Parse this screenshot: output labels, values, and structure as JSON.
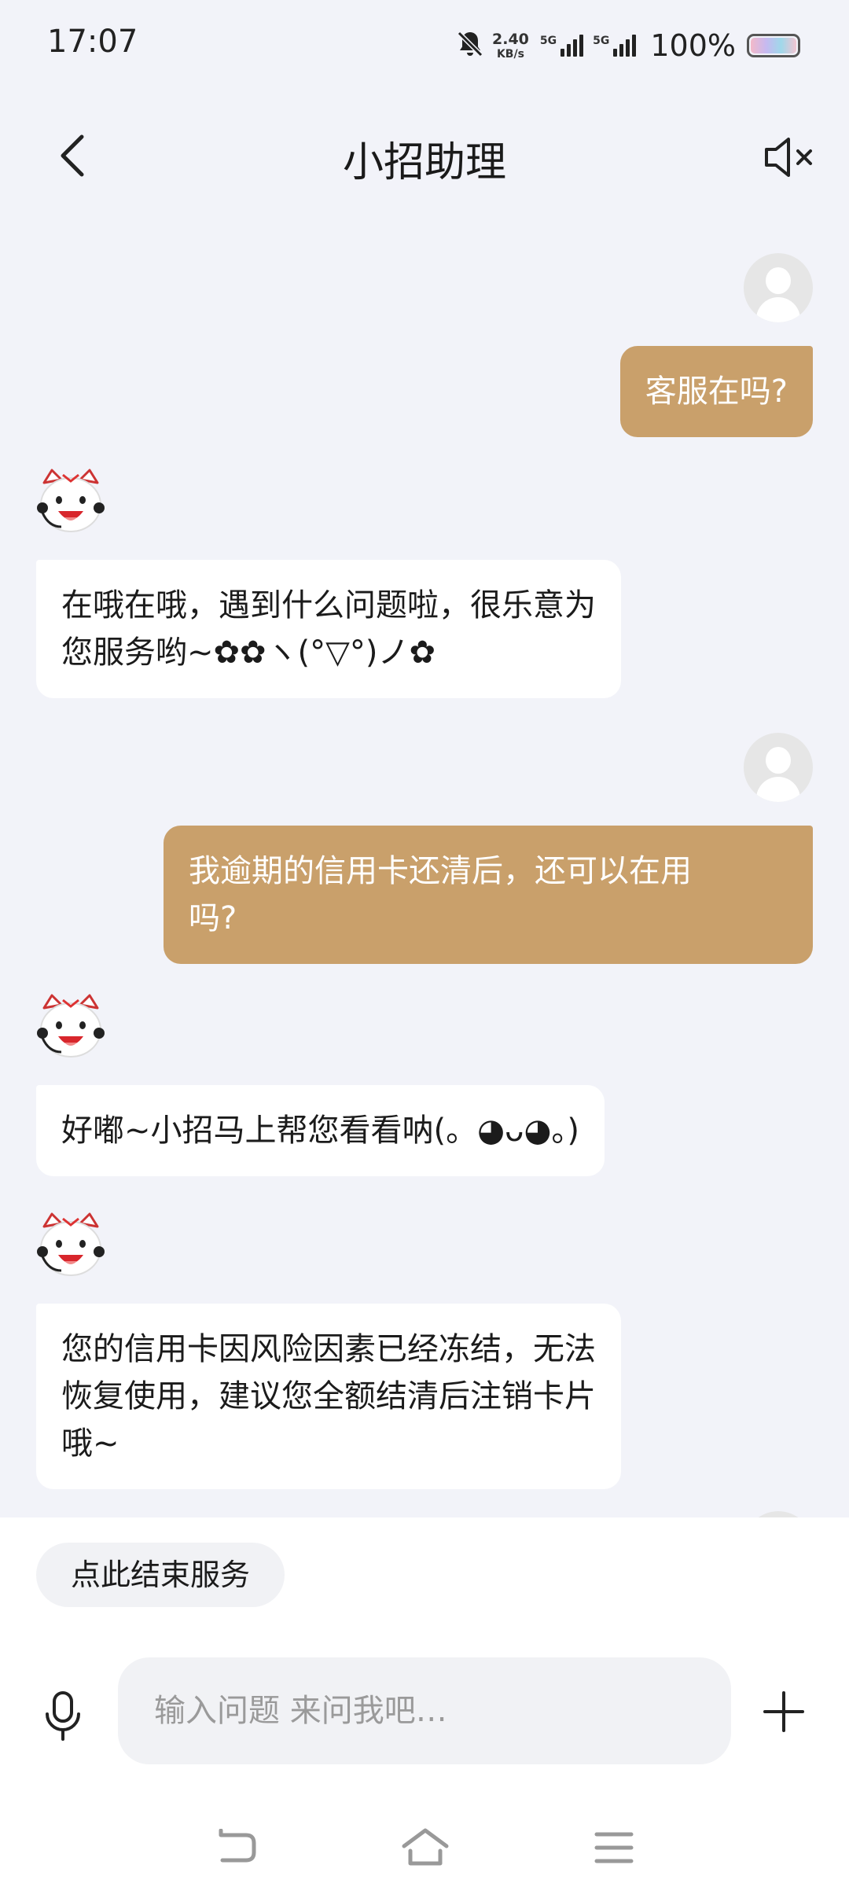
{
  "status_bar": {
    "time": "17:07",
    "net_speed_value": "2.40",
    "net_speed_unit": "KB/s",
    "sim1_label": "5G",
    "sim2_label": "5G",
    "battery_percent": "100%",
    "icons": [
      "bell-muted-icon",
      "signal-icon",
      "battery-icon"
    ]
  },
  "header": {
    "title": "小招助理",
    "back_icon": "chevron-left-icon",
    "mute_icon": "speaker-muted-icon"
  },
  "messages": [
    {
      "sender": "user",
      "text": "客服在吗?"
    },
    {
      "sender": "bot",
      "text": "在哦在哦，遇到什么问题啦，很乐意为\n您服务哟~✿✿ヽ(°▽°)ノ✿"
    },
    {
      "sender": "user",
      "text": "我逾期的信用卡还清后，还可以在用\n吗?"
    },
    {
      "sender": "bot",
      "text": "好嘟~小招马上帮您看看呐(。◕ᴗ◕。)"
    },
    {
      "sender": "bot",
      "text": "您的信用卡因风险因素已经冻结，无法\n恢复使用，建议您全额结清后注销卡片\n哦~"
    }
  ],
  "bottom": {
    "end_service_label": "点此结束服务",
    "input_placeholder": "输入问题 来问我吧…",
    "mic_icon": "microphone-icon",
    "plus_icon": "plus-icon"
  },
  "nav": {
    "icons": [
      "back-nav-icon",
      "home-nav-icon",
      "menu-nav-icon"
    ]
  },
  "colors": {
    "background": "#f2f3f9",
    "user_bubble": "#c9a06b",
    "bot_bubble": "#ffffff",
    "bottom_panel": "#ffffff"
  }
}
